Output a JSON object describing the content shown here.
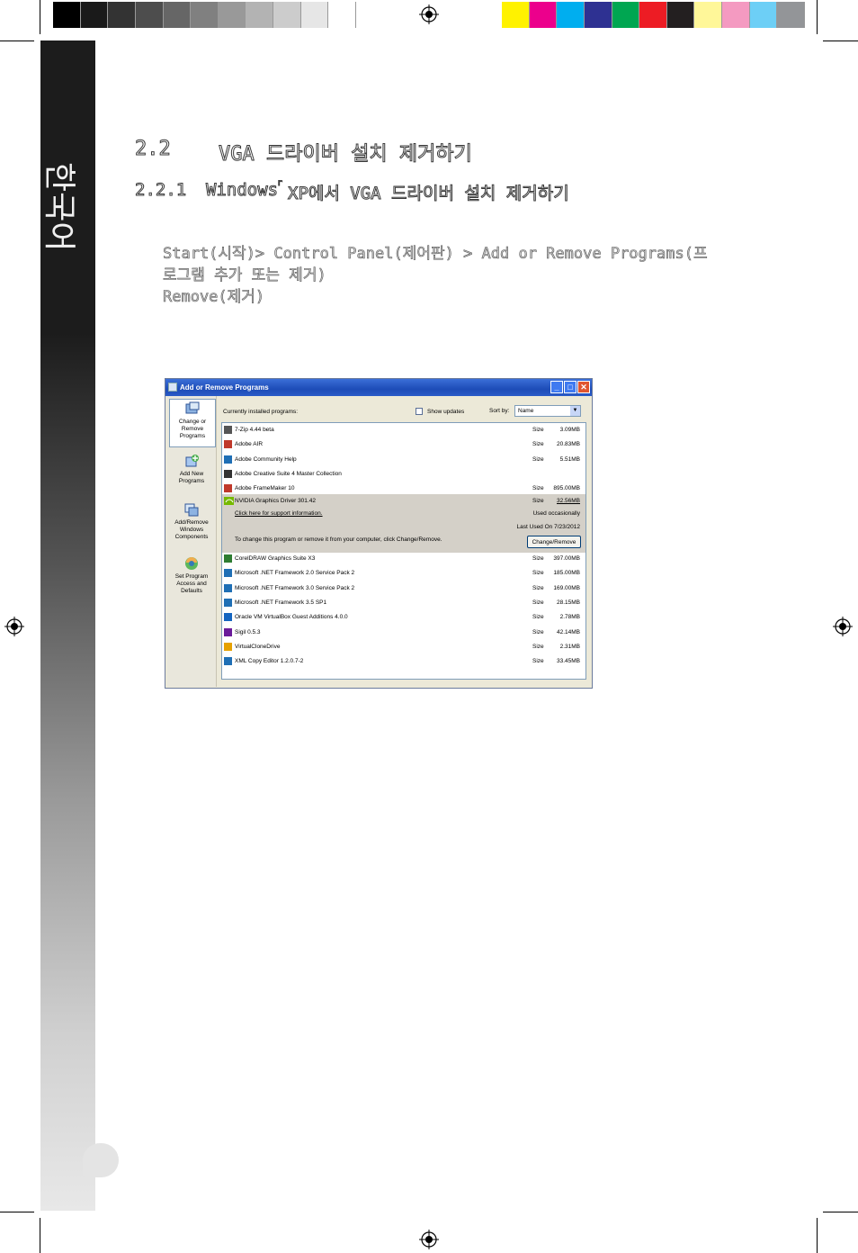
{
  "print_marks": {
    "gray_swatches": [
      "#000000",
      "#1a1a1a",
      "#333333",
      "#4d4d4d",
      "#666666",
      "#808080",
      "#999999",
      "#b3b3b3",
      "#cccccc",
      "#e6e6e6",
      "#ffffff"
    ],
    "color_swatches": [
      "#fff200",
      "#ec008c",
      "#00aeef",
      "#2e3192",
      "#00a651",
      "#ed1c24",
      "#231f20",
      "#fff799",
      "#f49ac1",
      "#6dcff6",
      "#939598"
    ]
  },
  "sidebar": {
    "label": "한국어"
  },
  "section": {
    "number": "2.2",
    "title": "VGA 드라이버 설치 제거하기"
  },
  "subsection": {
    "number": "2.2.1",
    "title": "Windows",
    "superscript": "r",
    "title_rest": "XP에서 VGA 드라이버 설치 제거하기"
  },
  "instructions": {
    "line1": "Start(시작)> Control Panel(제어판) > Add or Remove Programs(프",
    "line2": "로그램 추가 또는 제거)",
    "line3": "Remove(제거)"
  },
  "window": {
    "title": "Add or Remove Programs",
    "buttons": {
      "minimize": "_",
      "maximize": "□",
      "close": "✕"
    },
    "left_pane": [
      {
        "label": "Change or Remove Programs",
        "icon": "change-remove-icon",
        "active": true
      },
      {
        "label": "Add New Programs",
        "icon": "add-programs-icon",
        "active": false
      },
      {
        "label": "Add/Remove Windows Components",
        "icon": "windows-components-icon",
        "active": false
      },
      {
        "label": "Set Program Access and Defaults",
        "icon": "program-defaults-icon",
        "active": false
      }
    ],
    "header": {
      "installed_label": "Currently installed programs:",
      "show_updates_label": "Show updates",
      "show_updates_checked": false,
      "sort_label": "Sort by:",
      "sort_value": "Name"
    },
    "size_label": "Size",
    "programs_top": [
      {
        "name": "7-Zip 4.44 beta",
        "size": "3.09MB"
      },
      {
        "name": "Adobe AIR",
        "size": "20.83MB"
      },
      {
        "name": "Adobe Community Help",
        "size": "5.51MB"
      },
      {
        "name": "Adobe Creative Suite 4 Master Collection",
        "size": ""
      },
      {
        "name": "Adobe FrameMaker 10",
        "size": "895.00MB"
      }
    ],
    "selected_program": {
      "name": "NVIDIA Graphics Driver 301.42",
      "size": "32.56MB",
      "support_link": "Click here for support information.",
      "used": "Used occasionally",
      "last_used": "Last Used On  7/23/2012",
      "description": "To change this program or remove it from your computer, click Change/Remove.",
      "button": "Change/Remove"
    },
    "programs_bottom": [
      {
        "name": "CorelDRAW Graphics Suite X3",
        "size": "397.00MB"
      },
      {
        "name": "Microsoft .NET Framework 2.0 Service Pack 2",
        "size": "185.00MB"
      },
      {
        "name": "Microsoft .NET Framework 3.0 Service Pack 2",
        "size": "169.00MB"
      },
      {
        "name": "Microsoft .NET Framework 3.5 SP1",
        "size": "28.15MB"
      },
      {
        "name": "Oracle VM VirtualBox Guest Additions 4.0.0",
        "size": "2.78MB"
      },
      {
        "name": "Sigil 0.5.3",
        "size": "42.14MB"
      },
      {
        "name": "VirtualCloneDrive",
        "size": "2.31MB"
      },
      {
        "name": "XML Copy Editor 1.2.0.7-2",
        "size": "33.45MB"
      }
    ]
  }
}
